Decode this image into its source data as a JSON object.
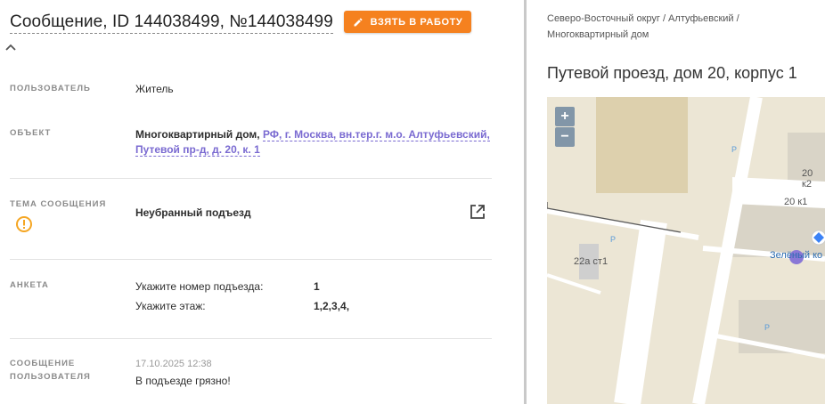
{
  "header": {
    "title": "Сообщение, ID 144038499, №144038499",
    "take_button": "ВЗЯТЬ В РАБОТУ"
  },
  "rows": {
    "user": {
      "label": "ПОЛЬЗОВАТЕЛЬ",
      "value": "Житель"
    },
    "object": {
      "label": "ОБЪЕКТ",
      "type": "Многоквартирный дом,",
      "address_line1": "РФ, г. Москва, вн.тер.г. м.о. Алтуфьевский,",
      "address_line2": "Путевой пр-д, д. 20, к. 1"
    },
    "topic": {
      "label": "ТЕМА СООБЩЕНИЯ",
      "value": "Неубранный подъезд"
    },
    "survey": {
      "label": "АНКЕТА",
      "items": [
        {
          "key": "Укажите номер подъезда:",
          "value": "1"
        },
        {
          "key": "Укажите этаж:",
          "value": "1,2,3,4,"
        }
      ]
    },
    "message": {
      "label_line1": "СООБЩЕНИЕ",
      "label_line2": "ПОЛЬЗОВАТЕЛЯ",
      "time": "17.10.2025 12:38",
      "text": "В подъезде грязно!"
    }
  },
  "right": {
    "breadcrumb_line1": "Северо-Восточный округ / Алтуфьевский /",
    "breadcrumb_line2": "Многоквартирный дом",
    "address": "Путевой проезд, дом 20, корпус 1",
    "map": {
      "zoom_in": "+",
      "zoom_out": "−",
      "labels": {
        "b20k2": "20 к2",
        "b20k1": "20 к1",
        "b22a": "22а ст1",
        "green": "Зелёный ко",
        "p": "P"
      }
    }
  },
  "colors": {
    "accent": "#f5811f",
    "link": "#7a6ad1",
    "warning": "#f5a623",
    "marker": "#8a78d6"
  }
}
